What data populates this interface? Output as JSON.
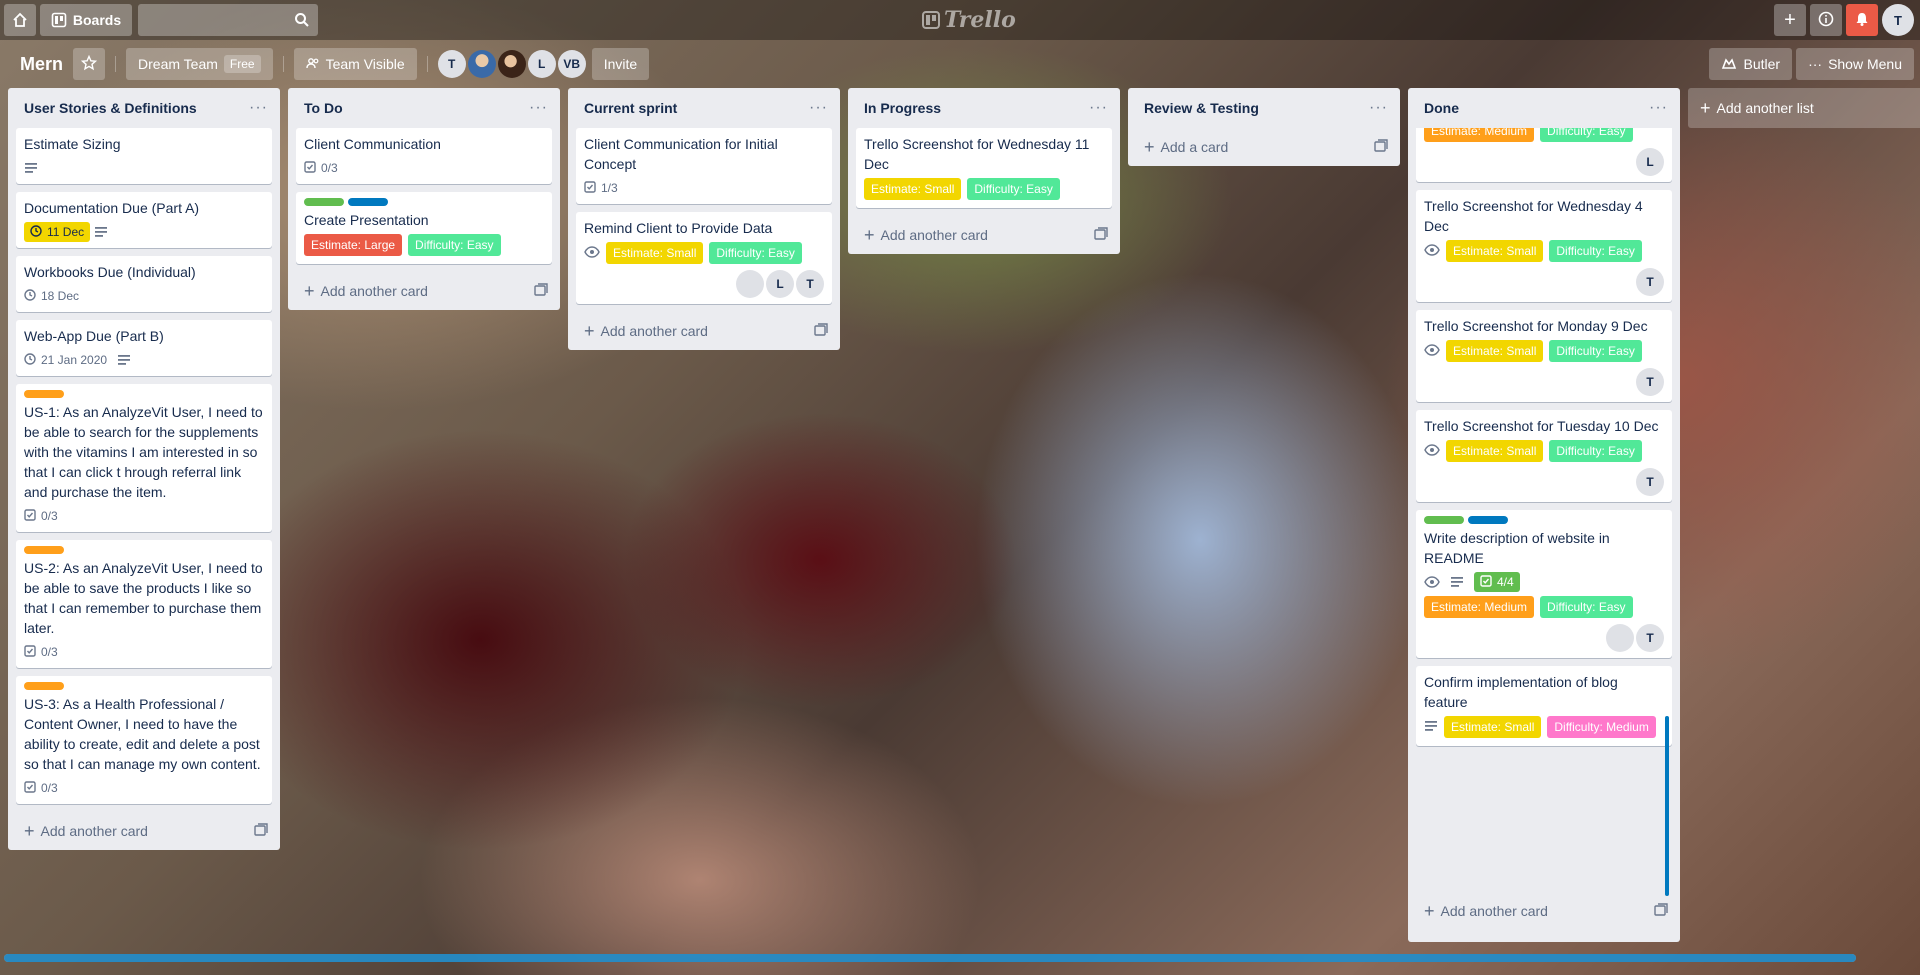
{
  "topbar": {
    "boards_label": "Boards",
    "logo_text": "Trello",
    "user_initial": "T"
  },
  "board": {
    "name": "Mern",
    "team_label": "Dream Team",
    "team_badge": "Free",
    "visibility_label": "Team Visible",
    "invite_label": "Invite",
    "butler_label": "Butler",
    "show_menu_label": "Show Menu",
    "members": [
      "T",
      "",
      "",
      "L",
      "VB"
    ]
  },
  "add_list_label": "Add another list",
  "add_card_label": "Add another card",
  "lists": [
    {
      "title": "User Stories & Definitions",
      "cards": [
        {
          "title": "Estimate Sizing"
        },
        {
          "title": "Documentation Due (Part A)",
          "due": "11 Dec"
        },
        {
          "title": "Workbooks Due (Individual)",
          "date": "18 Dec"
        },
        {
          "title": "Web-App Due (Part B)",
          "date": "21 Jan 2020"
        },
        {
          "title": "US-1: As an AnalyzeVit User, I need to be able to search for the supplements with the vitamins I am interested in so that I can click t hrough referral link and purchase the item.",
          "checklist": "0/3"
        },
        {
          "title": "US-2: As an AnalyzeVit User, I need to be able to save the products I like so that I can remember to purchase them later.",
          "checklist": "0/3"
        },
        {
          "title": "US-3: As a Health Professional / Content Owner, I need to have the ability to create, edit and delete a post so that I can manage my own content.",
          "checklist": "0/3"
        }
      ]
    },
    {
      "title": "To Do",
      "cards": [
        {
          "title": "Client Communication",
          "checklist": "0/3"
        },
        {
          "title": "Create Presentation",
          "tags": [
            "Estimate: Large",
            "Difficulty: Easy"
          ]
        }
      ]
    },
    {
      "title": "Current sprint",
      "cards": [
        {
          "title": "Client Communication for Initial Concept",
          "checklist": "1/3"
        },
        {
          "title": "Remind Client to Provide Data",
          "tags": [
            "Estimate: Small",
            "Difficulty: Easy"
          ],
          "members": [
            "L",
            "T"
          ]
        }
      ]
    },
    {
      "title": "In Progress",
      "cards": [
        {
          "title": "Trello Screenshot for Wednesday 11 Dec",
          "tags": [
            "Estimate: Small",
            "Difficulty: Easy"
          ]
        }
      ]
    },
    {
      "title": "Review & Testing",
      "cards": []
    },
    {
      "title": "Done",
      "cards": [
        {
          "title": "",
          "tags": [
            "Estimate: Medium",
            "Difficulty: Easy"
          ],
          "members": [
            "L"
          ]
        },
        {
          "title": "Trello Screenshot for Wednesday 4 Dec",
          "tags": [
            "Estimate: Small",
            "Difficulty: Easy"
          ],
          "members": [
            "T"
          ]
        },
        {
          "title": "Trello Screenshot for Monday 9 Dec",
          "tags": [
            "Estimate: Small",
            "Difficulty: Easy"
          ],
          "members": [
            "T"
          ]
        },
        {
          "title": "Trello Screenshot for Tuesday 10 Dec",
          "tags": [
            "Estimate: Small",
            "Difficulty: Easy"
          ],
          "members": [
            "T"
          ]
        },
        {
          "title": "Write description of website in README",
          "checklist": "4/4",
          "tags": [
            "Estimate: Medium",
            "Difficulty: Easy"
          ],
          "members": [
            "T"
          ]
        },
        {
          "title": "Confirm implementation of blog feature",
          "tags": [
            "Estimate: Small",
            "Difficulty: Medium"
          ]
        }
      ]
    }
  ],
  "colors": {
    "label_green": "#61bd4f",
    "label_blue": "#0079bf",
    "label_orange": "#ff9f1a",
    "tag_yellow": "#f2d600",
    "tag_green": "#51e898",
    "tag_red": "#eb5a46",
    "tag_orange": "#ff9f1a",
    "tag_pink": "#ff78cb"
  }
}
